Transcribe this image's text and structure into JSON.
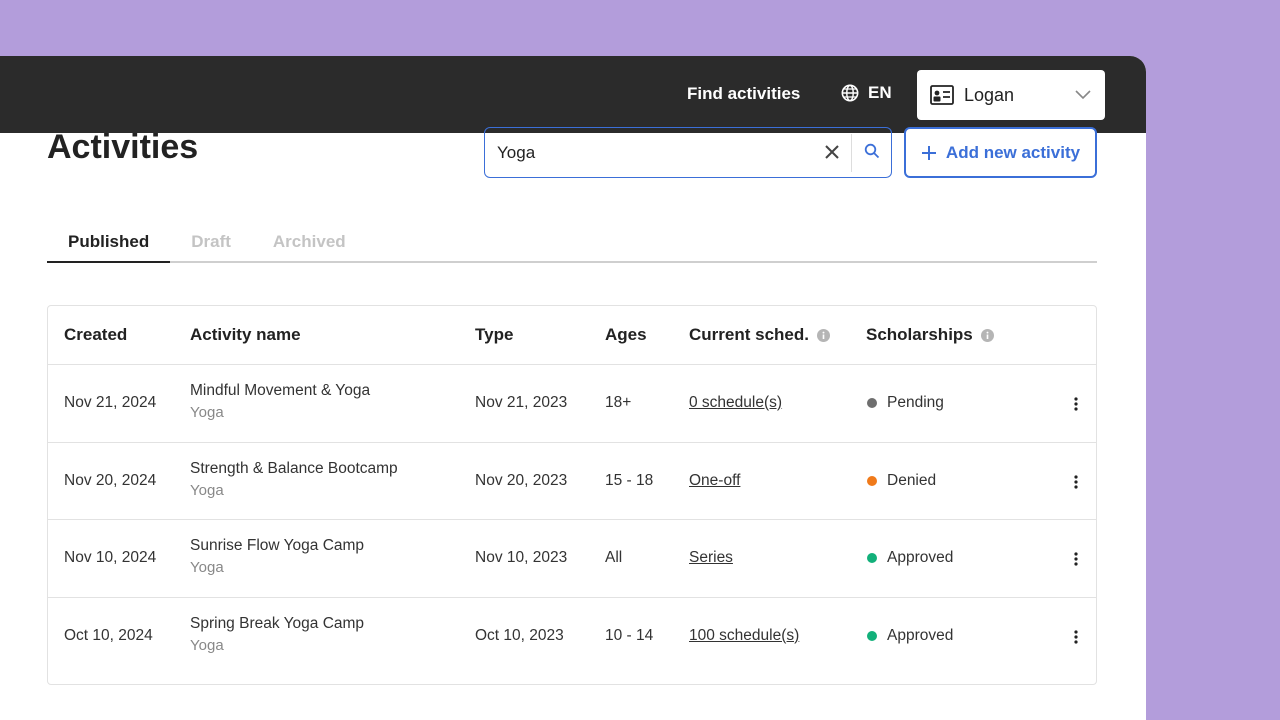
{
  "header": {
    "find_label": "Find activities",
    "lang_label": "EN",
    "user_name": "Logan"
  },
  "page": {
    "title": "Activities"
  },
  "search": {
    "value": "Yoga"
  },
  "add_button": {
    "label": "Add new activity"
  },
  "tabs": [
    {
      "label": "Published",
      "active": true
    },
    {
      "label": "Draft",
      "active": false
    },
    {
      "label": "Archived",
      "active": false
    }
  ],
  "table": {
    "columns": [
      "Created",
      "Activity name",
      "Type",
      "Ages",
      "Current sched.",
      "Scholarships"
    ],
    "rows": [
      {
        "created": "Nov 21, 2024",
        "name": "Mindful Movement & Yoga",
        "category": "Yoga",
        "type": "Nov 21, 2023",
        "ages": "18+",
        "schedule": "0 schedule(s)",
        "scholarship": "Pending",
        "status_color": "#6e6e6e"
      },
      {
        "created": "Nov 20, 2024",
        "name": "Strength & Balance Bootcamp",
        "category": "Yoga",
        "type": "Nov 20, 2023",
        "ages": "15 - 18",
        "schedule": "One-off",
        "scholarship": "Denied",
        "status_color": "#f07a1a"
      },
      {
        "created": "Nov 10, 2024",
        "name": "Sunrise Flow Yoga Camp",
        "category": "Yoga",
        "type": "Nov 10, 2023",
        "ages": "All",
        "schedule": "Series",
        "scholarship": "Approved",
        "status_color": "#12b07a"
      },
      {
        "created": "Oct 10, 2024",
        "name": "Spring Break Yoga Camp",
        "category": "Yoga",
        "type": "Oct 10, 2023",
        "ages": "10 - 14",
        "schedule": "100 schedule(s)",
        "scholarship": "Approved",
        "status_color": "#12b07a"
      }
    ]
  },
  "colors": {
    "accent": "#3b6fd8",
    "topbar": "#2b2b2b",
    "backdrop": "#b39ddb"
  }
}
